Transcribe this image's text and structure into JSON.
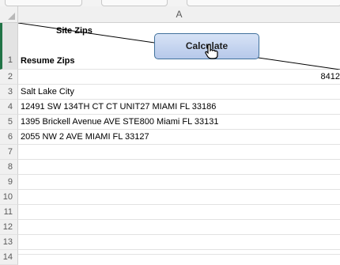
{
  "column_header": "A",
  "row_numbers": [
    "1",
    "2",
    "3",
    "4",
    "5",
    "6",
    "7",
    "8",
    "9",
    "10",
    "11",
    "12",
    "13",
    "14"
  ],
  "cells": {
    "a1_upper": "Site Zips",
    "a1_lower": "Resume Zips",
    "a2": "8412",
    "a3": "Salt Lake City",
    "a4": "12491 SW 134TH CT CT UNIT27 MIAMI FL 33186",
    "a5": "1395 Brickell Avenue AVE STE800 Miami FL 33131",
    "a6": "2055 NW 2 AVE   MIAMI FL 33127"
  },
  "button": {
    "label": "Calculate"
  },
  "icons": {
    "cursor": "hand-pointer-icon",
    "corner": "select-all-triangle-icon"
  },
  "colors": {
    "selected_row_accent": "#217346",
    "button_border": "#41719c"
  }
}
